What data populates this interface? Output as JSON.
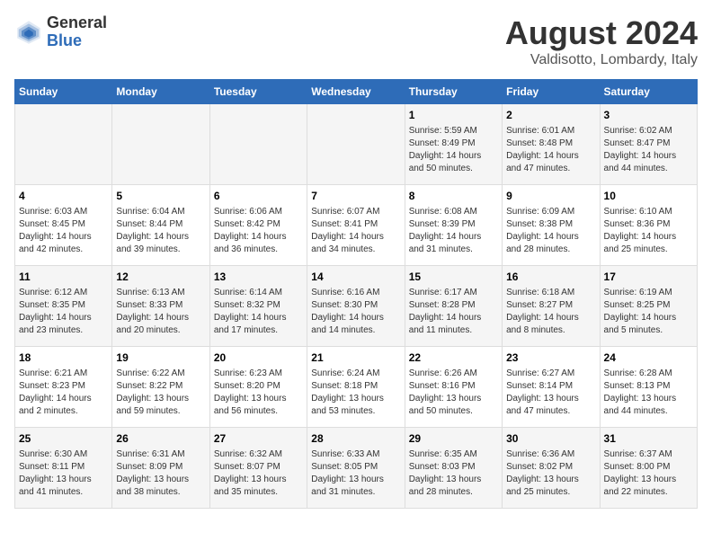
{
  "logo": {
    "general": "General",
    "blue": "Blue"
  },
  "title": "August 2024",
  "subtitle": "Valdisotto, Lombardy, Italy",
  "days_of_week": [
    "Sunday",
    "Monday",
    "Tuesday",
    "Wednesday",
    "Thursday",
    "Friday",
    "Saturday"
  ],
  "weeks": [
    [
      {
        "day": "",
        "content": ""
      },
      {
        "day": "",
        "content": ""
      },
      {
        "day": "",
        "content": ""
      },
      {
        "day": "",
        "content": ""
      },
      {
        "day": "1",
        "content": "Sunrise: 5:59 AM\nSunset: 8:49 PM\nDaylight: 14 hours\nand 50 minutes."
      },
      {
        "day": "2",
        "content": "Sunrise: 6:01 AM\nSunset: 8:48 PM\nDaylight: 14 hours\nand 47 minutes."
      },
      {
        "day": "3",
        "content": "Sunrise: 6:02 AM\nSunset: 8:47 PM\nDaylight: 14 hours\nand 44 minutes."
      }
    ],
    [
      {
        "day": "4",
        "content": "Sunrise: 6:03 AM\nSunset: 8:45 PM\nDaylight: 14 hours\nand 42 minutes."
      },
      {
        "day": "5",
        "content": "Sunrise: 6:04 AM\nSunset: 8:44 PM\nDaylight: 14 hours\nand 39 minutes."
      },
      {
        "day": "6",
        "content": "Sunrise: 6:06 AM\nSunset: 8:42 PM\nDaylight: 14 hours\nand 36 minutes."
      },
      {
        "day": "7",
        "content": "Sunrise: 6:07 AM\nSunset: 8:41 PM\nDaylight: 14 hours\nand 34 minutes."
      },
      {
        "day": "8",
        "content": "Sunrise: 6:08 AM\nSunset: 8:39 PM\nDaylight: 14 hours\nand 31 minutes."
      },
      {
        "day": "9",
        "content": "Sunrise: 6:09 AM\nSunset: 8:38 PM\nDaylight: 14 hours\nand 28 minutes."
      },
      {
        "day": "10",
        "content": "Sunrise: 6:10 AM\nSunset: 8:36 PM\nDaylight: 14 hours\nand 25 minutes."
      }
    ],
    [
      {
        "day": "11",
        "content": "Sunrise: 6:12 AM\nSunset: 8:35 PM\nDaylight: 14 hours\nand 23 minutes."
      },
      {
        "day": "12",
        "content": "Sunrise: 6:13 AM\nSunset: 8:33 PM\nDaylight: 14 hours\nand 20 minutes."
      },
      {
        "day": "13",
        "content": "Sunrise: 6:14 AM\nSunset: 8:32 PM\nDaylight: 14 hours\nand 17 minutes."
      },
      {
        "day": "14",
        "content": "Sunrise: 6:16 AM\nSunset: 8:30 PM\nDaylight: 14 hours\nand 14 minutes."
      },
      {
        "day": "15",
        "content": "Sunrise: 6:17 AM\nSunset: 8:28 PM\nDaylight: 14 hours\nand 11 minutes."
      },
      {
        "day": "16",
        "content": "Sunrise: 6:18 AM\nSunset: 8:27 PM\nDaylight: 14 hours\nand 8 minutes."
      },
      {
        "day": "17",
        "content": "Sunrise: 6:19 AM\nSunset: 8:25 PM\nDaylight: 14 hours\nand 5 minutes."
      }
    ],
    [
      {
        "day": "18",
        "content": "Sunrise: 6:21 AM\nSunset: 8:23 PM\nDaylight: 14 hours\nand 2 minutes."
      },
      {
        "day": "19",
        "content": "Sunrise: 6:22 AM\nSunset: 8:22 PM\nDaylight: 13 hours\nand 59 minutes."
      },
      {
        "day": "20",
        "content": "Sunrise: 6:23 AM\nSunset: 8:20 PM\nDaylight: 13 hours\nand 56 minutes."
      },
      {
        "day": "21",
        "content": "Sunrise: 6:24 AM\nSunset: 8:18 PM\nDaylight: 13 hours\nand 53 minutes."
      },
      {
        "day": "22",
        "content": "Sunrise: 6:26 AM\nSunset: 8:16 PM\nDaylight: 13 hours\nand 50 minutes."
      },
      {
        "day": "23",
        "content": "Sunrise: 6:27 AM\nSunset: 8:14 PM\nDaylight: 13 hours\nand 47 minutes."
      },
      {
        "day": "24",
        "content": "Sunrise: 6:28 AM\nSunset: 8:13 PM\nDaylight: 13 hours\nand 44 minutes."
      }
    ],
    [
      {
        "day": "25",
        "content": "Sunrise: 6:30 AM\nSunset: 8:11 PM\nDaylight: 13 hours\nand 41 minutes."
      },
      {
        "day": "26",
        "content": "Sunrise: 6:31 AM\nSunset: 8:09 PM\nDaylight: 13 hours\nand 38 minutes."
      },
      {
        "day": "27",
        "content": "Sunrise: 6:32 AM\nSunset: 8:07 PM\nDaylight: 13 hours\nand 35 minutes."
      },
      {
        "day": "28",
        "content": "Sunrise: 6:33 AM\nSunset: 8:05 PM\nDaylight: 13 hours\nand 31 minutes."
      },
      {
        "day": "29",
        "content": "Sunrise: 6:35 AM\nSunset: 8:03 PM\nDaylight: 13 hours\nand 28 minutes."
      },
      {
        "day": "30",
        "content": "Sunrise: 6:36 AM\nSunset: 8:02 PM\nDaylight: 13 hours\nand 25 minutes."
      },
      {
        "day": "31",
        "content": "Sunrise: 6:37 AM\nSunset: 8:00 PM\nDaylight: 13 hours\nand 22 minutes."
      }
    ]
  ]
}
